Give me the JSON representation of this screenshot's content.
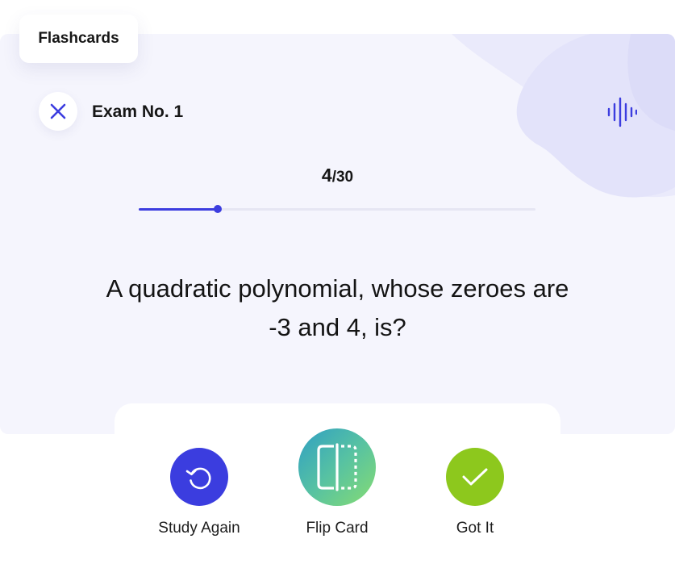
{
  "tag": {
    "label": "Flashcards"
  },
  "header": {
    "close_icon": "close-icon",
    "title": "Exam No. 1",
    "audio_icon": "audio-waveform-icon"
  },
  "progress": {
    "current": "4",
    "total_text": "/30",
    "fraction": 0.2
  },
  "question": {
    "text": "A quadratic polynomial, whose zeroes are -3 and 4, is?"
  },
  "actions": [
    {
      "label": "Study Again",
      "icon": "refresh-icon",
      "color": "#3b3ddf"
    },
    {
      "label": "Flip Card",
      "icon": "flip-card-icon",
      "color": "#57c2a2"
    },
    {
      "label": "Got It",
      "icon": "checkmark-icon",
      "color": "#8dc81d"
    }
  ],
  "colors": {
    "accent": "#3c3ddf",
    "card_background": "#f5f5fd",
    "decoration": "#e3e3fa"
  }
}
